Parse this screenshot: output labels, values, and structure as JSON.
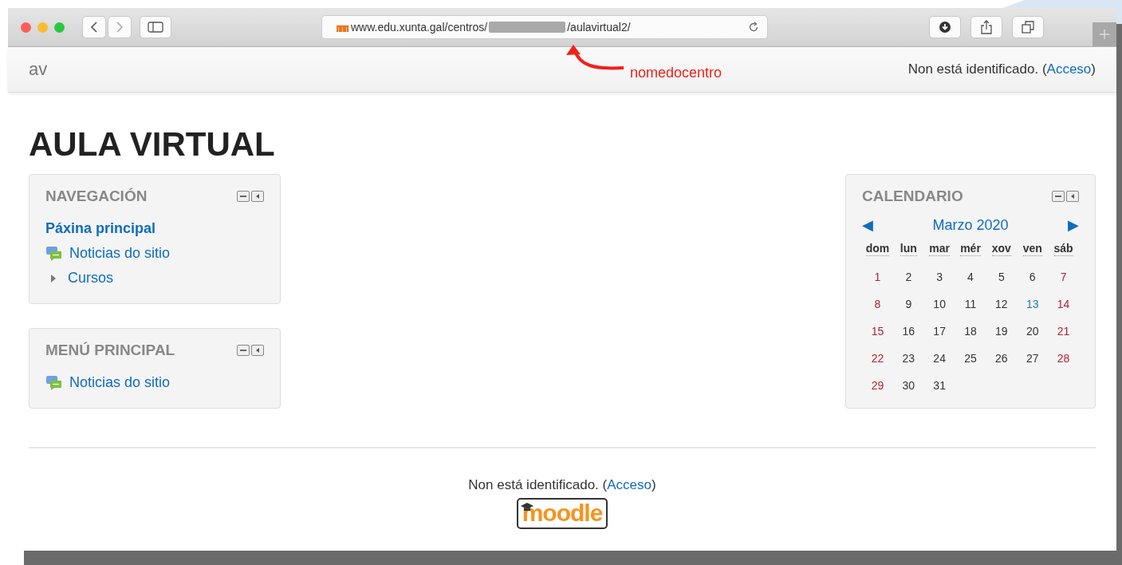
{
  "browser": {
    "url_start": "www.edu.xunta.gal/centros/",
    "url_end": "/aulavirtual2/"
  },
  "annotation": {
    "label": "nomedocentro"
  },
  "header": {
    "brand": "av",
    "login_text": "Non está identificado. (",
    "login_link": "Acceso",
    "login_end": ")"
  },
  "page_title": "AULA VIRTUAL",
  "navigation": {
    "title": "NAVEGACIÓN",
    "items": [
      {
        "label": "Páxina principal",
        "kind": "home"
      },
      {
        "label": "Noticias do sitio",
        "kind": "forum"
      },
      {
        "label": "Cursos",
        "kind": "branch",
        "expanded": false
      }
    ]
  },
  "main_menu": {
    "title": "MENÚ PRINCIPAL",
    "items": [
      {
        "label": "Noticias do sitio",
        "kind": "forum"
      }
    ]
  },
  "calendar": {
    "title": "CALENDARIO",
    "month": "Marzo 2020",
    "prev": "◀",
    "next": "▶",
    "weekdays": [
      "dom",
      "lun",
      "mar",
      "mér",
      "xov",
      "ven",
      "sáb"
    ],
    "weeks": [
      [
        {
          "day": "1",
          "kind": "weekend"
        },
        {
          "day": "2",
          "kind": "normal"
        },
        {
          "day": "3",
          "kind": "normal"
        },
        {
          "day": "4",
          "kind": "normal"
        },
        {
          "day": "5",
          "kind": "normal"
        },
        {
          "day": "6",
          "kind": "normal"
        },
        {
          "day": "7",
          "kind": "weekend"
        }
      ],
      [
        {
          "day": "8",
          "kind": "weekend"
        },
        {
          "day": "9",
          "kind": "normal"
        },
        {
          "day": "10",
          "kind": "normal"
        },
        {
          "day": "11",
          "kind": "normal"
        },
        {
          "day": "12",
          "kind": "normal"
        },
        {
          "day": "13",
          "kind": "today"
        },
        {
          "day": "14",
          "kind": "weekend"
        }
      ],
      [
        {
          "day": "15",
          "kind": "weekend"
        },
        {
          "day": "16",
          "kind": "normal"
        },
        {
          "day": "17",
          "kind": "normal"
        },
        {
          "day": "18",
          "kind": "normal"
        },
        {
          "day": "19",
          "kind": "normal"
        },
        {
          "day": "20",
          "kind": "normal"
        },
        {
          "day": "21",
          "kind": "weekend"
        }
      ],
      [
        {
          "day": "22",
          "kind": "weekend"
        },
        {
          "day": "23",
          "kind": "normal"
        },
        {
          "day": "24",
          "kind": "normal"
        },
        {
          "day": "25",
          "kind": "normal"
        },
        {
          "day": "26",
          "kind": "normal"
        },
        {
          "day": "27",
          "kind": "normal"
        },
        {
          "day": "28",
          "kind": "weekend"
        }
      ],
      [
        {
          "day": "29",
          "kind": "weekend"
        },
        {
          "day": "30",
          "kind": "normal"
        },
        {
          "day": "31",
          "kind": "normal"
        }
      ]
    ]
  },
  "footer": {
    "login_text": "Non está identificado. (",
    "login_link": "Acceso",
    "login_end": ")",
    "logo": "moodle"
  }
}
